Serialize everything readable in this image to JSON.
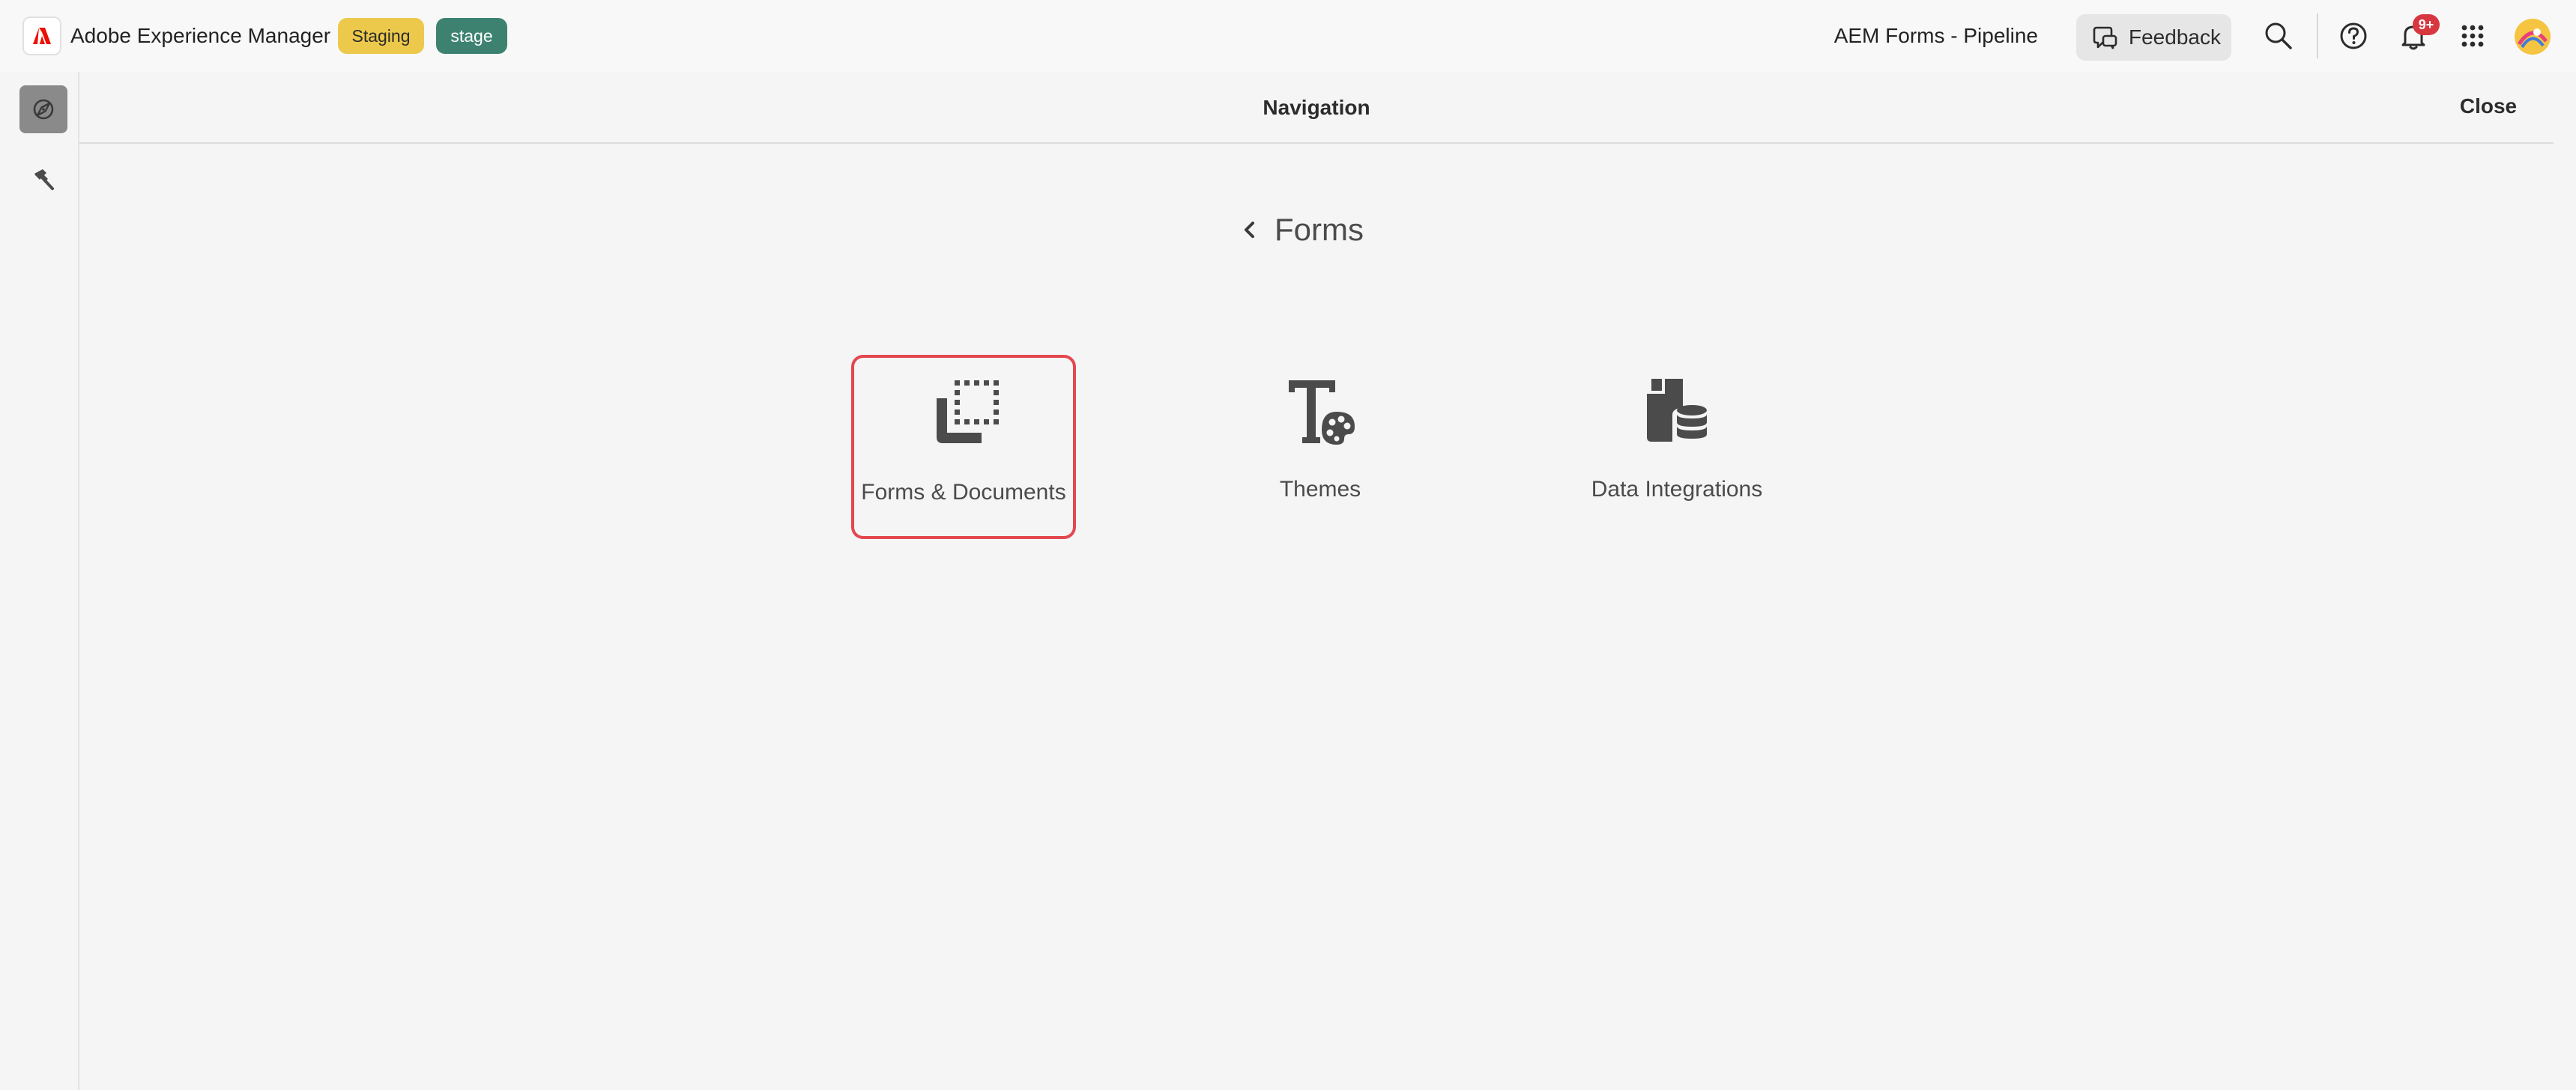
{
  "header": {
    "app_title": "Adobe Experience Manager",
    "badges": {
      "staging": "Staging",
      "stage": "stage"
    },
    "program": "AEM Forms - Pipeline",
    "feedback_label": "Feedback",
    "notification_count": "9+",
    "icons": [
      "adobe-logo-icon",
      "feedback-icon",
      "search-icon",
      "help-icon",
      "bell-icon",
      "apps-grid-icon",
      "avatar"
    ]
  },
  "rail": {
    "items": [
      {
        "icon": "navigation-compass-icon",
        "active": true
      },
      {
        "icon": "tools-hammer-icon",
        "active": false
      }
    ]
  },
  "panel": {
    "title": "Navigation",
    "close_label": "Close",
    "breadcrumb": "Forms",
    "tiles": [
      {
        "label": "Forms & Documents",
        "icon": "forms-documents-icon",
        "selected": true
      },
      {
        "label": "Themes",
        "icon": "themes-icon",
        "selected": false
      },
      {
        "label": "Data Integrations",
        "icon": "data-integrations-icon",
        "selected": false
      }
    ]
  },
  "colors": {
    "brand_red": "#eb1000",
    "staging_badge": "#ecc94b",
    "stage_badge": "#3d8270",
    "selection_outline": "#e34850",
    "notification_badge": "#d7373f"
  }
}
